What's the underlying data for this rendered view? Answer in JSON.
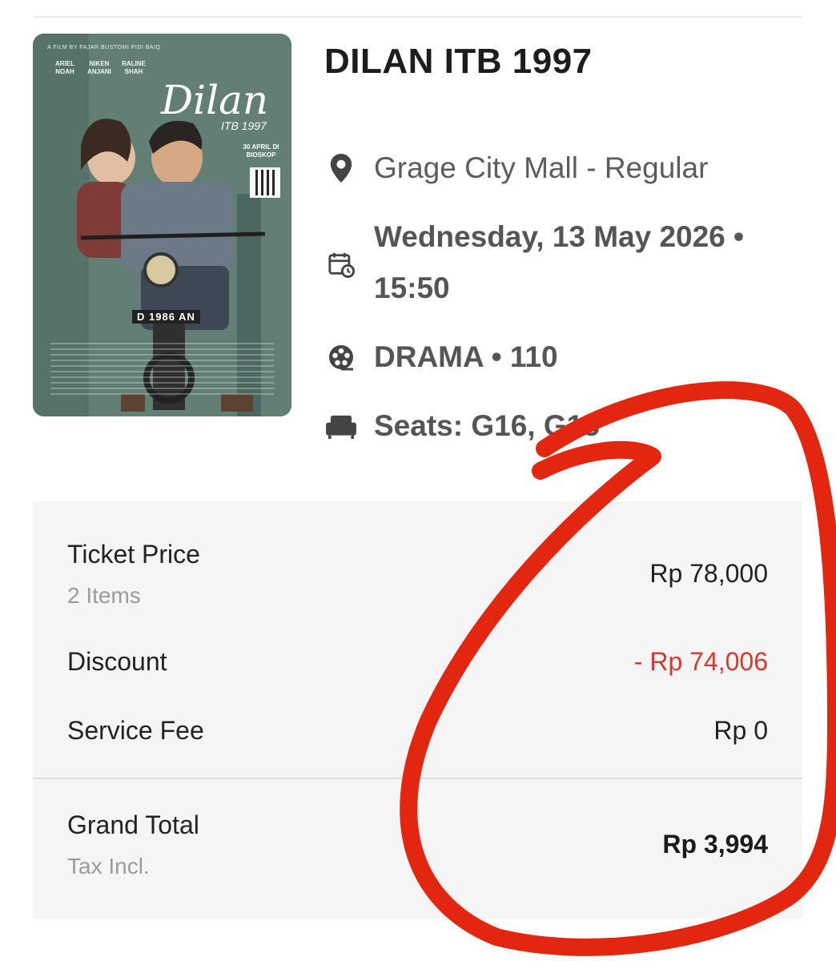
{
  "movie": {
    "title": "DILAN ITB 1997",
    "location": "Grage City Mall - Regular",
    "datetime": "Wednesday, 13 May 2026 • 15:50",
    "genre_duration": "DRAMA • 110",
    "seats": "Seats: G16, G15",
    "poster": {
      "credit_top": "A FILM BY  FAJAR BUSTOMI   PIDI BAIQ",
      "cast": [
        "ARIEL NOAH",
        "NIKEN ANJANI",
        "RALINE SHAH"
      ],
      "logo": "Dilan",
      "logo_sub": "ITB 1997",
      "release": "30 APRIL DI BIOSKOP",
      "plate": "D 1986 AN"
    }
  },
  "pricing": {
    "ticket_label": "Ticket Price",
    "ticket_items": "2 Items",
    "ticket_value": "Rp 78,000",
    "discount_label": "Discount",
    "discount_value": "- Rp 74,006",
    "fee_label": "Service Fee",
    "fee_value": "Rp 0",
    "total_label": "Grand Total",
    "total_sub": "Tax Incl.",
    "total_value": "Rp 3,994"
  },
  "colors": {
    "discount": "#d9382e",
    "annotation": "#e3260f",
    "icon": "#444444"
  },
  "icons": [
    "location-pin-icon",
    "calendar-clock-icon",
    "film-reel-icon",
    "seat-sofa-icon"
  ]
}
